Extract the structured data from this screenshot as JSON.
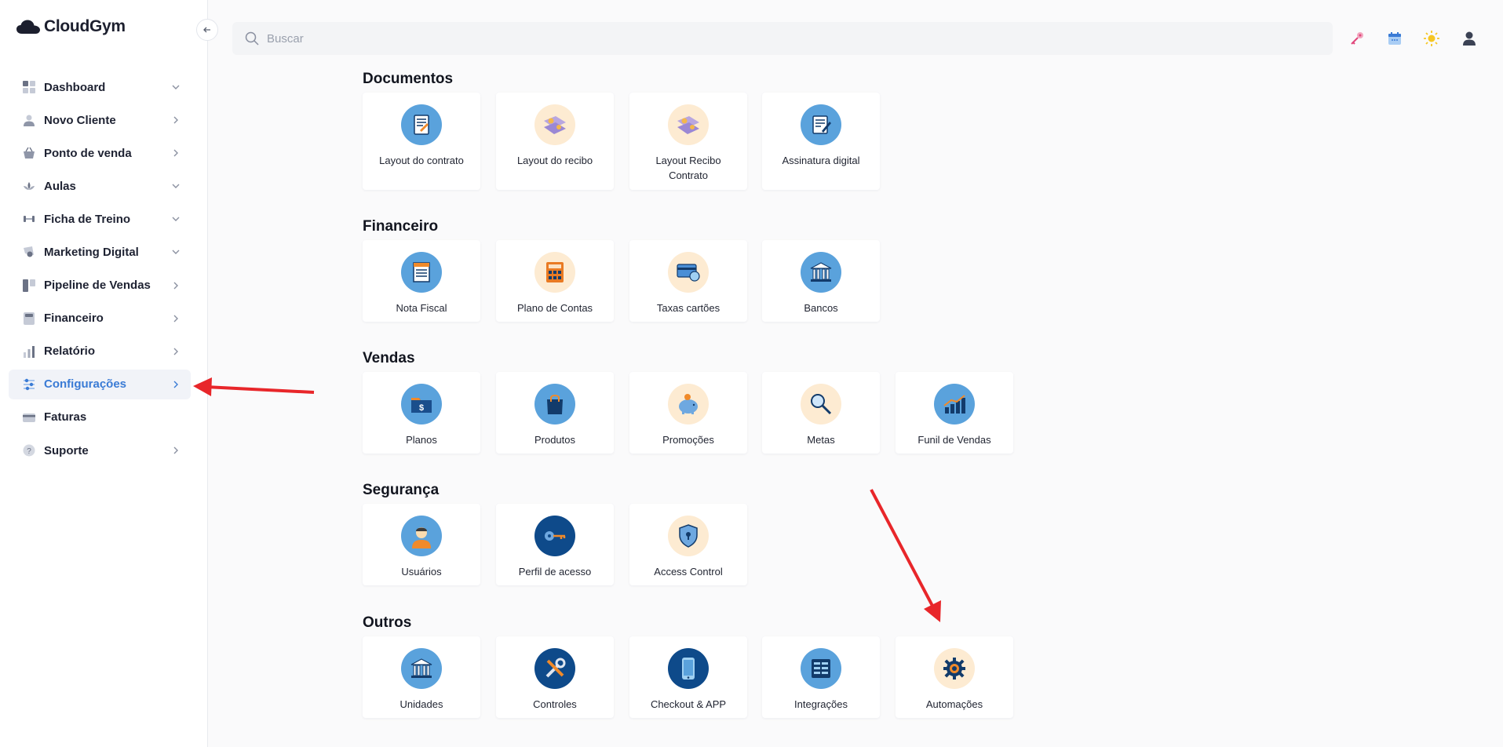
{
  "app": {
    "name": "CloudGym"
  },
  "search": {
    "placeholder": "Buscar"
  },
  "sidebar": {
    "items": [
      {
        "label": "Dashboard",
        "chevron": "down",
        "icon": "dashboard-icon"
      },
      {
        "label": "Novo Cliente",
        "chevron": "right",
        "icon": "user-icon"
      },
      {
        "label": "Ponto de venda",
        "chevron": "right",
        "icon": "basket-icon"
      },
      {
        "label": "Aulas",
        "chevron": "down",
        "icon": "lotus-icon"
      },
      {
        "label": "Ficha de Treino",
        "chevron": "down",
        "icon": "dumbbell-icon"
      },
      {
        "label": "Marketing Digital",
        "chevron": "down",
        "icon": "megaphone-icon"
      },
      {
        "label": "Pipeline de Vendas",
        "chevron": "right",
        "icon": "pipeline-icon"
      },
      {
        "label": "Financeiro",
        "chevron": "right",
        "icon": "calculator-icon"
      },
      {
        "label": "Relatório",
        "chevron": "right",
        "icon": "bar-chart-icon"
      },
      {
        "label": "Configurações",
        "chevron": "right",
        "icon": "sliders-icon",
        "active": true
      },
      {
        "label": "Faturas",
        "chevron": "",
        "icon": "credit-card-icon"
      },
      {
        "label": "Suporte",
        "chevron": "right",
        "icon": "help-icon"
      }
    ]
  },
  "sections": [
    {
      "title": "Documentos",
      "cards": [
        "Layout do contrato",
        "Layout do recibo",
        "Layout Recibo Contrato",
        "Assinatura digital"
      ]
    },
    {
      "title": "Financeiro",
      "cards": [
        "Nota Fiscal",
        "Plano de Contas",
        "Taxas cartões",
        "Bancos"
      ]
    },
    {
      "title": "Vendas",
      "cards": [
        "Planos",
        "Produtos",
        "Promoções",
        "Metas",
        "Funil de Vendas"
      ]
    },
    {
      "title": "Segurança",
      "cards": [
        "Usuários",
        "Perfil de acesso",
        "Access Control"
      ]
    },
    {
      "title": "Outros",
      "cards": [
        "Unidades",
        "Controles",
        "Checkout & APP",
        "Integrações",
        "Automações"
      ]
    }
  ],
  "colors": {
    "accent": "#3a7bd5",
    "annotation_arrow": "#e8262a"
  }
}
